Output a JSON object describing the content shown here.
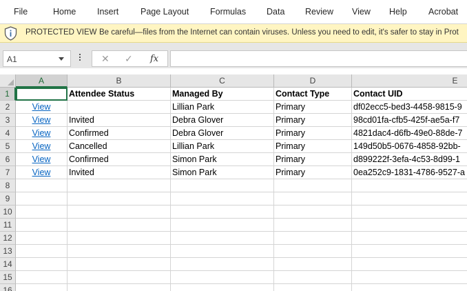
{
  "ribbon": {
    "tabs": [
      "File",
      "Home",
      "Insert",
      "Page Layout",
      "Formulas",
      "Data",
      "Review",
      "View",
      "Help",
      "Acrobat"
    ]
  },
  "protected_view": {
    "title": "PROTECTED VIEW",
    "message": "Be careful—files from the Internet can contain viruses. Unless you need to edit, it's safer to stay in Prot",
    "icon": "shield-icon",
    "background_color": "#fff5c2"
  },
  "formula_bar": {
    "name_box": "A1",
    "cancel_glyph": "✕",
    "enter_glyph": "✓",
    "fx_label": "fx",
    "formula": ""
  },
  "sheet": {
    "columns": [
      "A",
      "B",
      "C",
      "D",
      "E"
    ],
    "row_numbers": [
      "1",
      "2",
      "3",
      "4",
      "5",
      "6",
      "7",
      "8",
      "9",
      "10",
      "11",
      "12",
      "13",
      "14",
      "15",
      "16"
    ],
    "headers": [
      "",
      "Attendee Status",
      "Managed By",
      "Contact Type",
      "Contact UID"
    ],
    "rows": [
      [
        "View",
        "",
        "Lillian Park",
        "Primary",
        "df02ecc5-bed3-4458-9815-9"
      ],
      [
        "View",
        "Invited",
        "Debra Glover",
        "Primary",
        "98cd01fa-cfb5-425f-ae5a-f7"
      ],
      [
        "View",
        "Confirmed",
        "Debra Glover",
        "Primary",
        "4821dac4-d6fb-49e0-88de-7"
      ],
      [
        "View",
        "Cancelled",
        "Lillian Park",
        "Primary",
        "149d50b5-0676-4858-92bb-"
      ],
      [
        "View",
        "Confirmed",
        "Simon Park",
        "Primary",
        "d899222f-3efa-4c53-8d99-1"
      ],
      [
        "View",
        "Invited",
        "Simon Park",
        "Primary",
        "0ea252c9-1831-4786-9527-a"
      ]
    ],
    "selected_cell": "A1",
    "accent_color": "#217346",
    "link_color": "#0563c1"
  }
}
